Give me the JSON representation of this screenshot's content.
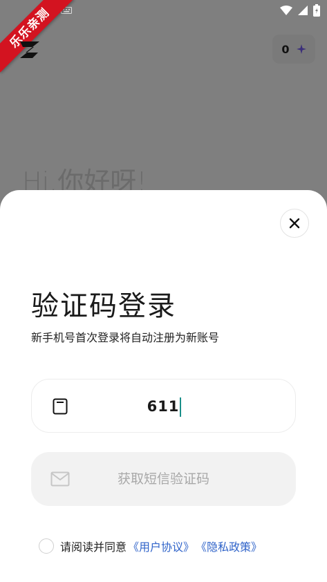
{
  "ribbon": {
    "text": "乐乐亲测"
  },
  "header": {
    "credit_count": "0"
  },
  "background": {
    "greeting": "Hi,你好呀!"
  },
  "sheet": {
    "title": "验证码登录",
    "subtitle": "新手机号首次登录将自动注册为新账号",
    "phone_value": "611",
    "sms_button_label": "获取短信验证码",
    "agree_text": "请阅读并同意",
    "user_agreement": "《用户协议》",
    "privacy_policy": "《隐私政策》"
  },
  "colors": {
    "link": "#2f63c9",
    "caret": "#1a8f8a",
    "ribbon": "#d31320"
  }
}
